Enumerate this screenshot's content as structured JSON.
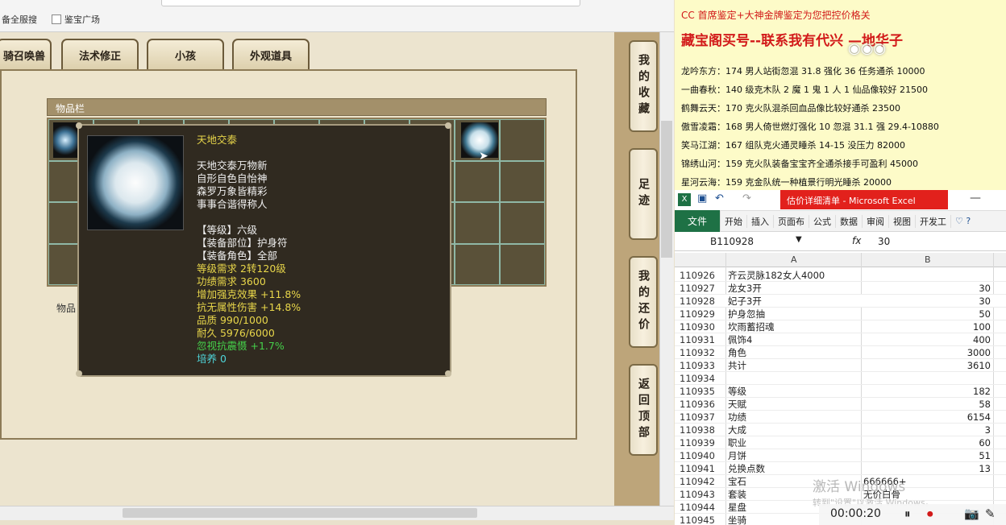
{
  "browser": {
    "bookmarks": [
      "备全服搜",
      "鉴宝广场"
    ]
  },
  "game": {
    "tabs": [
      "骑召唤兽",
      "法术修正",
      "小孩",
      "外观道具"
    ],
    "inventory_title": "物品栏",
    "inventory_label": "物品",
    "side_buttons": [
      "我的收藏",
      "足迹",
      "我的还价",
      "返回顶部"
    ]
  },
  "tooltip": {
    "name": "天地交泰",
    "desc": [
      "天地交泰万物新",
      "自形自色自怡神",
      "森罗万象皆精彩",
      "事事合谐得称人"
    ],
    "attrs_white": [
      "【等级】六级",
      "【装备部位】护身符",
      "【装备角色】全部"
    ],
    "attrs_yellow": [
      "等级需求 2转120级",
      "功绩需求 3600",
      "增加强克效果 +11.8%",
      "抗无属性伤害 +14.8%",
      "品质 990/1000",
      "耐久 5976/6000"
    ],
    "attr_green": "忽视抗震慑 +1.7%",
    "attr_cyan": "培养 0"
  },
  "info": {
    "line1": "CC 首席鉴定+大神金牌鉴定为您把控价格关",
    "line2": "藏宝阁买号--联系我有代兴 —地华子",
    "lines": [
      "龙吟东方：174 男人站街忽混 31.8 强化 36 任务通杀 10000",
      "一曲春秋：140 级克木队 2 魔 1 鬼 1 人 1 仙品像较好 21500",
      "鹤舞云天：170 克火队混杀回血品像比较好通杀 23500",
      "傲雪凌霜：168 男人倚世燃灯强化 10 忽混 31.1 强 29.4-10880",
      "笑马江湖：167 组队克火通灵睡杀 14-15 没压力 82000",
      "锦绣山河：159 克火队装备宝宝齐全通杀接手可盈利 45000",
      "星河云海：159 克金队统一种植景行明光睡杀 20000"
    ]
  },
  "excel": {
    "title": "估价详细清单 - Microsoft Excel",
    "ribbon": [
      "文件",
      "开始",
      "插入",
      "页面布",
      "公式",
      "数据",
      "审阅",
      "视图",
      "开发工"
    ],
    "name_box": "B110928",
    "formula_value": "30",
    "col_a": "A",
    "col_b": "B",
    "rows": [
      {
        "n": "110926",
        "a": "齐云灵脉182女人4000",
        "b": ""
      },
      {
        "n": "110927",
        "a": "龙女3开",
        "b": "30"
      },
      {
        "n": "110928",
        "a": "妃子3开",
        "b": "30"
      },
      {
        "n": "110929",
        "a": "护身忽抽",
        "b": "50"
      },
      {
        "n": "110930",
        "a": "坎雨蓄招魂",
        "b": "100"
      },
      {
        "n": "110931",
        "a": "佩饰4",
        "b": "400"
      },
      {
        "n": "110932",
        "a": "角色",
        "b": "3000"
      },
      {
        "n": "110933",
        "a": "共计",
        "b": "3610"
      },
      {
        "n": "110934",
        "a": "",
        "b": ""
      },
      {
        "n": "110935",
        "a": "等级",
        "b": "182"
      },
      {
        "n": "110936",
        "a": "天赋",
        "b": "58"
      },
      {
        "n": "110937",
        "a": "功绩",
        "b": "6154"
      },
      {
        "n": "110938",
        "a": "大成",
        "b": "3"
      },
      {
        "n": "110939",
        "a": "职业",
        "b": "60"
      },
      {
        "n": "110940",
        "a": "月饼",
        "b": "51"
      },
      {
        "n": "110941",
        "a": "兑换点数",
        "b": "13"
      },
      {
        "n": "110942",
        "a": "宝石",
        "b": "666666+"
      },
      {
        "n": "110943",
        "a": "套装",
        "b": "无价白骨"
      },
      {
        "n": "110944",
        "a": "星盘",
        "b": ""
      },
      {
        "n": "110945",
        "a": "坐骑",
        "b": ""
      }
    ],
    "watermark": "激活 Windows",
    "watermark_sub": "转到\"设置\"以激活 Windows。",
    "timer": "00:00:20"
  }
}
